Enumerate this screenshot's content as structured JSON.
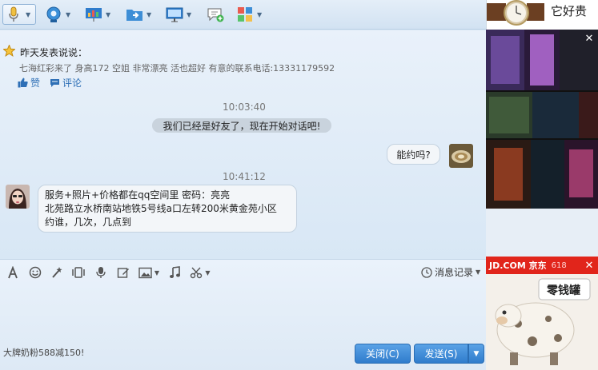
{
  "notice": {
    "title": "昨天发表说说：",
    "text": "七海红彩来了 身高172 空姐 非常漂亮 活也超好 有意的联系电话:13331179592",
    "like_label": "赞",
    "comment_label": "评论"
  },
  "messages": {
    "time1": "10:03:40",
    "system_text": "我们已经是好友了，现在开始对话吧!",
    "outgoing_text": "能约吗?",
    "time2": "10:41:12",
    "incoming_lines": [
      "服务+照片+价格都在qq空间里 密码：亮亮",
      "北苑路立水桥南站地铁5号线a口左转200米黄金苑小区",
      "约谁，几次，几点到"
    ]
  },
  "input": {
    "history_label": "消息记录",
    "footer_ad": "大牌奶粉588减150!",
    "close_label": "关闭(C)",
    "send_label": "发送(S)"
  },
  "ads": {
    "watch_text": "它好贵",
    "jd_brand": "JD.COM 京东",
    "jd_badge": "618",
    "piggy_text": "零钱罐"
  },
  "colors": {
    "accent": "#2f7ccc",
    "link": "#2e6fb6",
    "toolbar": "#d2e2f2",
    "chat_bg": "#e3edf8"
  }
}
